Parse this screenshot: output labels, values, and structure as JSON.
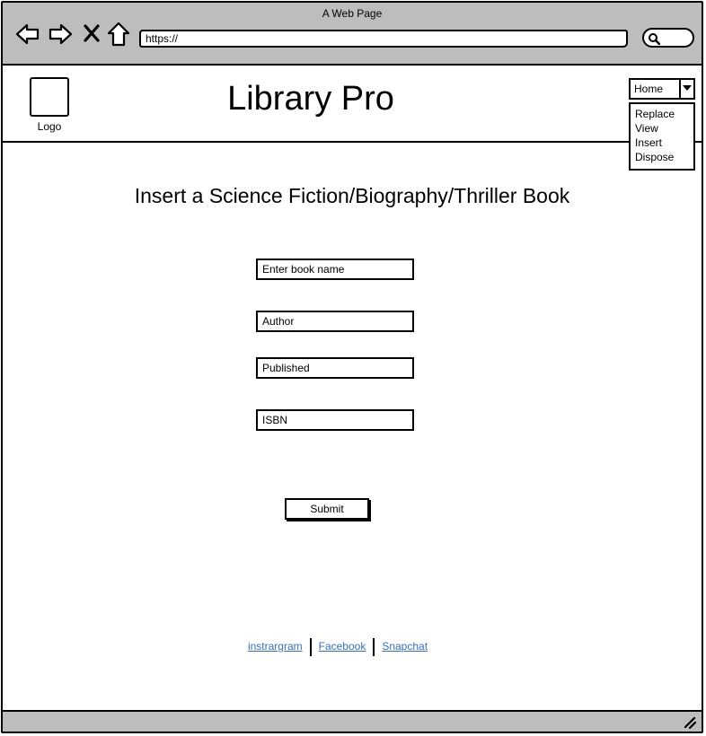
{
  "browser": {
    "window_title": "A Web Page",
    "url": "https://",
    "icons": [
      "back-arrow-icon",
      "forward-arrow-icon",
      "close-icon",
      "home-icon",
      "search-icon"
    ]
  },
  "header": {
    "logo_label": "Logo",
    "site_title": "Library Pro",
    "nav_select_value": "Home",
    "nav_menu": [
      "Replace",
      "View",
      "Insert",
      "Dispose"
    ]
  },
  "main": {
    "heading": "Insert a Science Fiction/Biography/Thriller Book",
    "fields": {
      "book_name": "Enter book name",
      "author": "Author",
      "published": "Published",
      "isbn": "ISBN"
    },
    "submit_label": "Submit"
  },
  "footer": {
    "links": [
      "instrargram",
      "Facebook",
      "Snapchat"
    ]
  },
  "colors": {
    "chrome": "#bdbdbd",
    "link": "#3a6fb8"
  }
}
